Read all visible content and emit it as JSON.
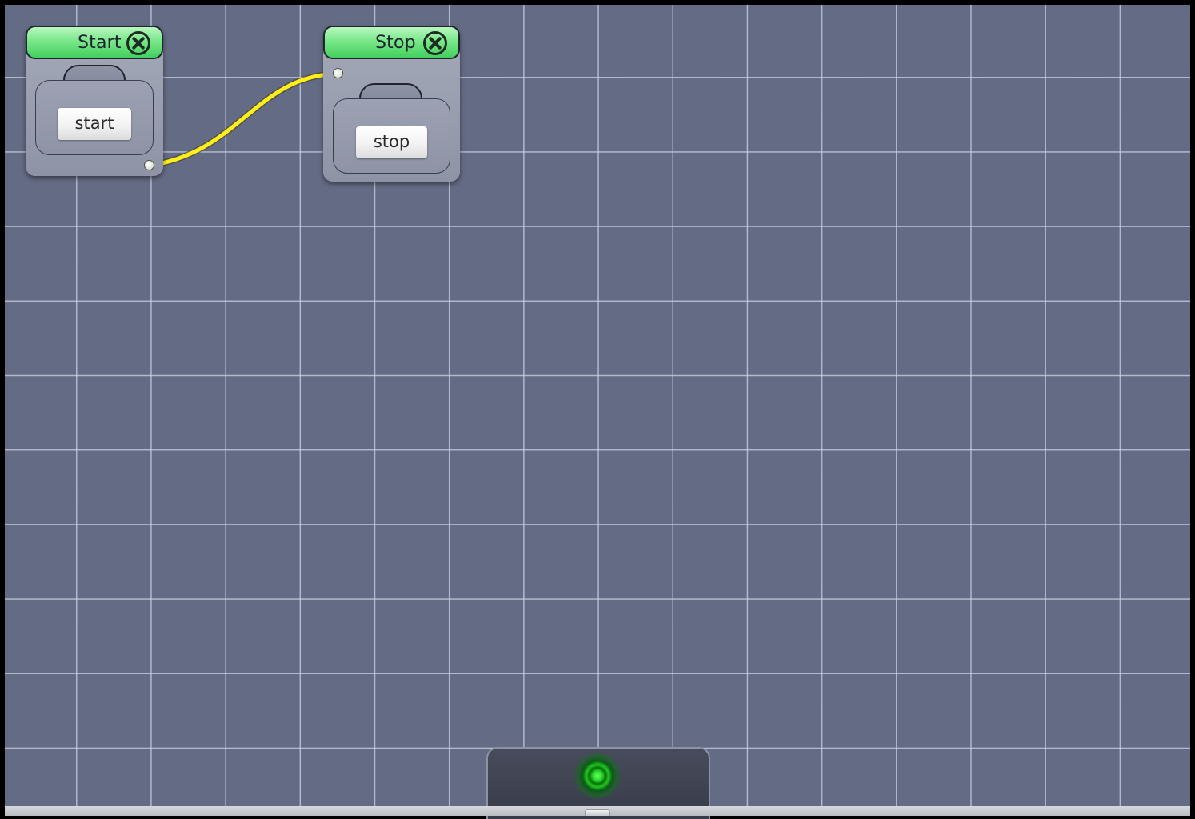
{
  "canvas": {
    "background_color": "#646b84",
    "grid_color": "#cdd2e4"
  },
  "nodes": [
    {
      "title": "Start",
      "button_label": "start",
      "header_color": "#79e88a",
      "icon": "close-icon"
    },
    {
      "title": "Stop",
      "button_label": "stop",
      "header_color": "#79e88a",
      "icon": "close-icon"
    }
  ],
  "connection": {
    "from": "Start",
    "to": "Stop",
    "color": "#ffee1a"
  },
  "status": {
    "indicator_color": "#26d326",
    "icon": "status-led-icon"
  }
}
